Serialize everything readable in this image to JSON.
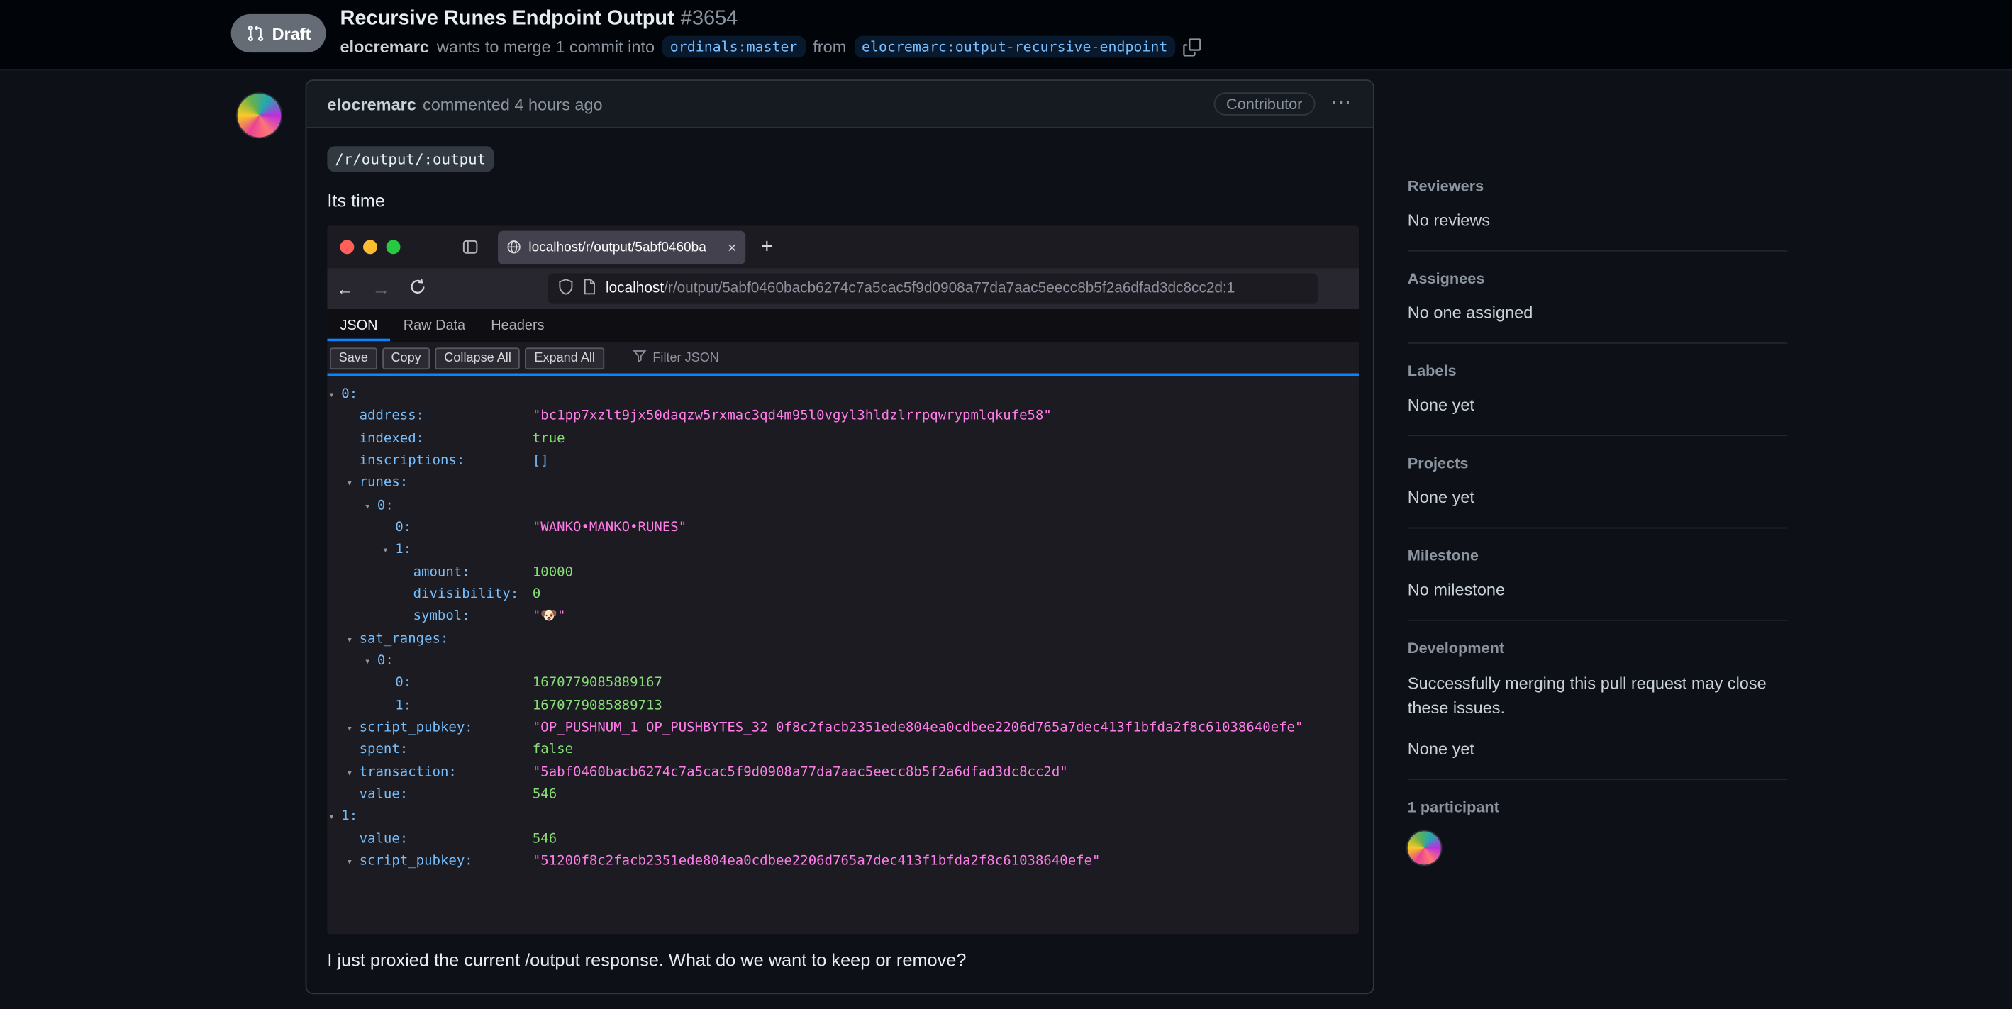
{
  "colors": {
    "page_bg": "#0d1117",
    "header_bg": "#010409",
    "card_border": "#30363d",
    "accent_blue": "#0a84ff",
    "branch_ref_blue": "#79c0ff",
    "json_key": "#75bfff",
    "json_string": "#ff7de9",
    "json_number": "#86de74",
    "draft_gray": "#656c76"
  },
  "pr": {
    "draft_label": "Draft",
    "title": "Recursive Runes Endpoint Output",
    "number": "#3654",
    "author": "elocremarc",
    "merge_text_1": "wants to merge 1 commit into",
    "base_branch": "ordinals:master",
    "merge_text_2": "from",
    "head_branch": "elocremarc:output-recursive-endpoint"
  },
  "comment": {
    "author": "elocremarc",
    "meta": "commented 4 hours ago",
    "badge": "Contributor",
    "options_glyph": "⋯",
    "code_span": "/r/output/:output",
    "para1": "Its time",
    "para2": "I just proxied the current /output response. What do we want to keep or remove?"
  },
  "browser": {
    "tab_title": "localhost/r/output/5abf0460ba",
    "tab_close_glyph": "×",
    "new_tab_glyph": "+",
    "back_glyph": "←",
    "forward_glyph": "→",
    "url_host": "localhost",
    "url_path": "/r/output/5abf0460bacb6274c7a5cac5f9d0908a77da7aac5eecc8b5f2a6dfad3dc8cc2d:1",
    "viewer_tabs": [
      "JSON",
      "Raw Data",
      "Headers"
    ],
    "toolbar_buttons": [
      "Save",
      "Copy",
      "Collapse All",
      "Expand All"
    ],
    "filter_label": "Filter JSON"
  },
  "json_rows": [
    {
      "key": "0:"
    },
    {
      "key": "address:",
      "value": "\"bc1pp7xzlt9jx50daqzw5rxmac3qd4m95l0vgyl3hldzlrrpqwrypmlqkufe58\""
    },
    {
      "key": "indexed:",
      "value": "true"
    },
    {
      "key": "inscriptions:",
      "value": "[]"
    },
    {
      "key": "runes:"
    },
    {
      "key": "0:"
    },
    {
      "key": "0:",
      "value": "\"WANKO•MANKO•RUNES\""
    },
    {
      "key": "1:"
    },
    {
      "key": "amount:",
      "value": "10000"
    },
    {
      "key": "divisibility:",
      "value": "0"
    },
    {
      "key": "symbol:",
      "value": "\"🐶\""
    },
    {
      "key": "sat_ranges:"
    },
    {
      "key": "0:"
    },
    {
      "key": "0:",
      "value": "1670779085889167"
    },
    {
      "key": "1:",
      "value": "1670779085889713"
    },
    {
      "key": "script_pubkey:",
      "value": "\"OP_PUSHNUM_1 OP_PUSHBYTES_32 0f8c2facb2351ede804ea0cdbee2206d765a7dec413f1bfda2f8c61038640efe\""
    },
    {
      "key": "spent:",
      "value": "false"
    },
    {
      "key": "transaction:",
      "value": "\"5abf0460bacb6274c7a5cac5f9d0908a77da7aac5eecc8b5f2a6dfad3dc8cc2d\""
    },
    {
      "key": "value:",
      "value": "546"
    },
    {
      "key": "1:"
    },
    {
      "key": "value:",
      "value": "546"
    },
    {
      "key": "script_pubkey:",
      "value": "\"51200f8c2facb2351ede804ea0cdbee2206d765a7dec413f1bfda2f8c61038640efe\""
    }
  ],
  "sidebar": {
    "sections": [
      {
        "title": "Reviewers",
        "body": "No reviews"
      },
      {
        "title": "Assignees",
        "body": "No one assigned"
      },
      {
        "title": "Labels",
        "body": "None yet"
      },
      {
        "title": "Projects",
        "body": "None yet"
      },
      {
        "title": "Milestone",
        "body": "No milestone"
      },
      {
        "title": "Development",
        "note": "Successfully merging this pull request may close these issues.",
        "body": "None yet"
      },
      {
        "title": "1 participant"
      }
    ]
  }
}
